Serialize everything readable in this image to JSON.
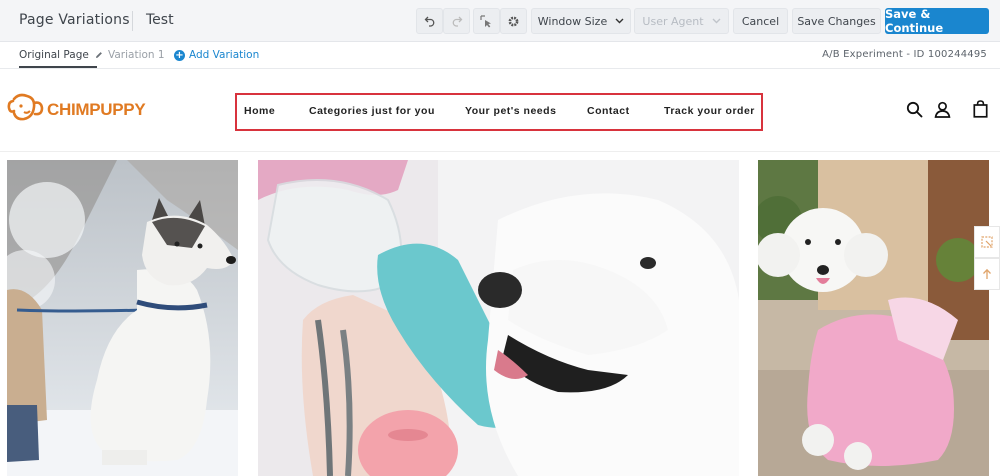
{
  "editor": {
    "page_title": "Page Variations",
    "experiment_name": "Test",
    "window_size_label": "Window Size",
    "user_agent_label": "User Agent",
    "cancel_label": "Cancel",
    "save_label": "Save Changes",
    "save_continue_label": "Save & Continue",
    "primary_color": "#1a86cf"
  },
  "tabs": {
    "original": "Original Page",
    "variation": "Variation 1",
    "add": "Add Variation",
    "experiment_id": "A/B Experiment - ID 100244495"
  },
  "site": {
    "logo_text": "CHIMPUPPY",
    "brand_color": "#e07a22",
    "highlight_color": "#d8333d",
    "nav": [
      "Home",
      "Categories just for you",
      "Your pet's needs",
      "Contact",
      "Track your order"
    ]
  },
  "icons": [
    "undo-icon",
    "redo-icon",
    "select-element-icon",
    "gear-icon",
    "chevron-down-icon",
    "pencil-icon",
    "plus-icon",
    "search-icon",
    "user-icon",
    "shopping-bag-icon",
    "resize-icon",
    "arrow-up-icon"
  ]
}
